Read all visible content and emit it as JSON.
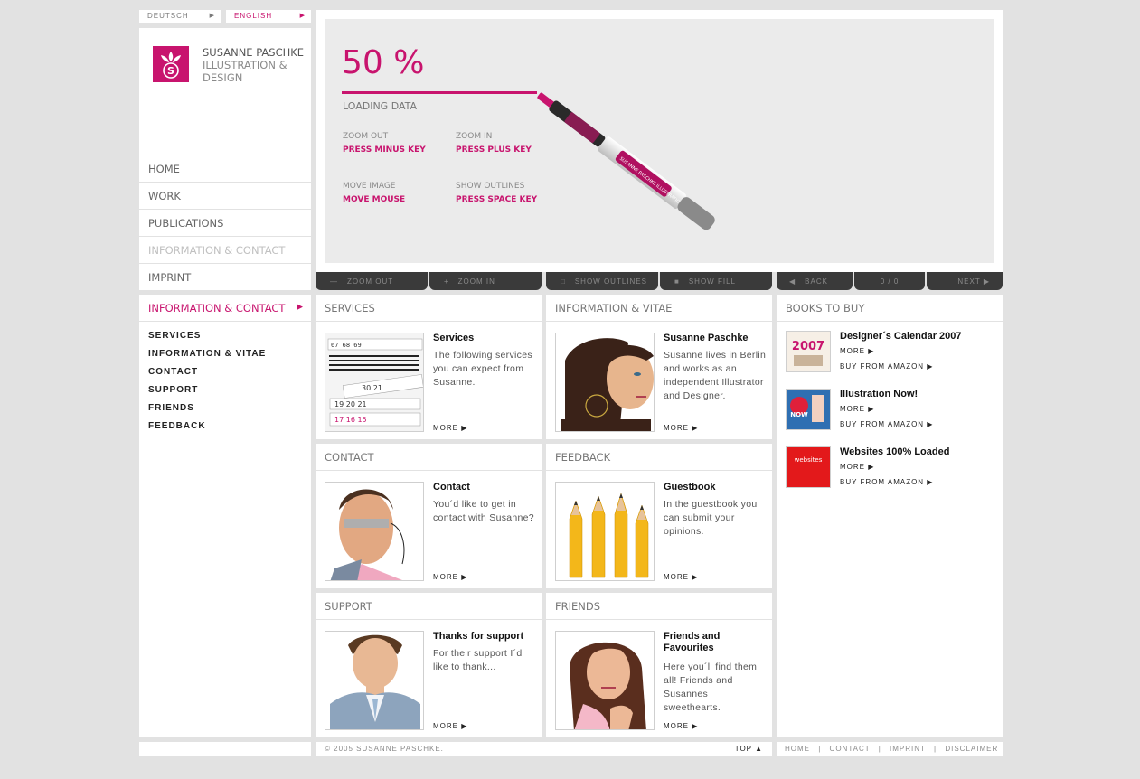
{
  "lang": {
    "deutsch": "DEUTSCH",
    "english": "ENGLISH",
    "arrow": "▶"
  },
  "logo": {
    "line1": "SUSANNE PASCHKE",
    "line2": "ILLUSTRATION &",
    "line3": "DESIGN"
  },
  "nav": [
    "HOME",
    "WORK",
    "PUBLICATIONS",
    "INFORMATION & CONTACT",
    "IMPRINT"
  ],
  "subnav": {
    "head": "INFORMATION & CONTACT",
    "items": [
      "SERVICES",
      "INFORMATION & VITAE",
      "CONTACT",
      "SUPPORT",
      "FRIENDS",
      "FEEDBACK"
    ]
  },
  "viewer": {
    "percent": "50 %",
    "progress": 0.5,
    "loading": "LOADING DATA",
    "hints": [
      {
        "label": "ZOOM OUT",
        "key": "PRESS MINUS KEY"
      },
      {
        "label": "ZOOM IN",
        "key": "PRESS PLUS KEY"
      },
      {
        "label": "MOVE IMAGE",
        "key": "MOVE MOUSE"
      },
      {
        "label": "SHOW OUTLINES",
        "key": "PRESS SPACE KEY"
      }
    ]
  },
  "toolbar": {
    "zoom_out": "ZOOM OUT",
    "zoom_in": "ZOOM IN",
    "show_outlines": "SHOW OUTLINES",
    "show_fill": "SHOW FILL",
    "back": "BACK",
    "counter": "0 / 0",
    "next": "NEXT"
  },
  "panels": {
    "services": {
      "head": "SERVICES",
      "title": "Services",
      "text": "The following services you can expect from Susanne.",
      "more": "MORE ▶"
    },
    "vitae": {
      "head": "INFORMATION & VITAE",
      "title": "Susanne Paschke",
      "text": "Susanne lives in Berlin and works as an independent Illustrator and Designer.",
      "more": "MORE ▶"
    },
    "contact": {
      "head": "CONTACT",
      "title": "Contact",
      "text": "You´d like to get in contact with Susanne?",
      "more": "MORE ▶"
    },
    "feedback": {
      "head": "FEEDBACK",
      "title": "Guestbook",
      "text": "In the guestbook you can submit your opinions.",
      "more": "MORE ▶"
    },
    "support": {
      "head": "SUPPORT",
      "title": "Thanks for support",
      "text": "For their support I´d like to thank...",
      "more": "MORE ▶"
    },
    "friends": {
      "head": "FRIENDS",
      "title": "Friends and Favourites",
      "text": "Here you´ll find them all! Friends and Susannes sweethearts.",
      "more": "MORE ▶"
    }
  },
  "books": {
    "head": "BOOKS TO BUY",
    "items": [
      {
        "title": "Designer´s Calendar 2007",
        "more": "MORE ▶",
        "buy": "BUY FROM AMAZON ▶",
        "cover_text": "2007"
      },
      {
        "title": "Illustration Now!",
        "more": "MORE ▶",
        "buy": "BUY FROM AMAZON ▶",
        "cover_text": "NOW"
      },
      {
        "title": "Websites 100% Loaded",
        "more": "MORE ▶",
        "buy": "BUY FROM AMAZON ▶",
        "cover_text": "websites"
      }
    ]
  },
  "footer": {
    "copyright": "© 2005 SUSANNE PASCHKE.",
    "top": "TOP ▲",
    "links": [
      "HOME",
      "CONTACT",
      "IMPRINT",
      "DISCLAIMER"
    ]
  },
  "colors": {
    "accent": "#c8146e",
    "background": "#e2e2e2",
    "toolbar": "#3a3a3a"
  },
  "pen_text": "SUSANNE PASCHKE ILLUSTRATION & DESIGN"
}
